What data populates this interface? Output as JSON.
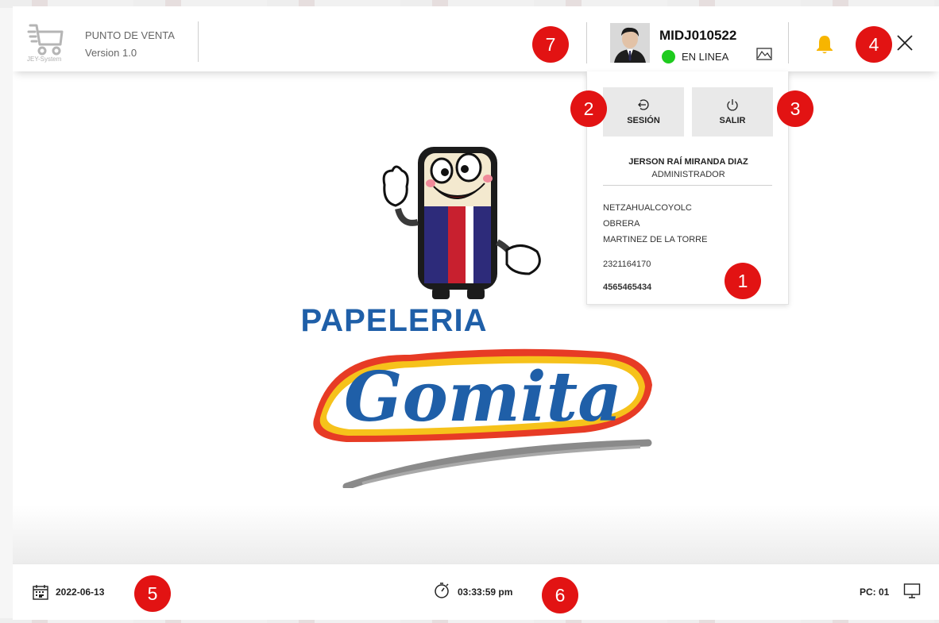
{
  "brand": {
    "title": "PUNTO DE VENTA",
    "version": "Version 1.0",
    "sub": "JEY-System"
  },
  "header": {
    "user_id": "MIDJ010522",
    "status_text": "EN LINEA"
  },
  "dropdown": {
    "session_label": "SESIÓN",
    "exit_label": "SALIR",
    "name": "JERSON RAÍ MIRANDA DIAZ",
    "role": "ADMINISTRADOR",
    "location": "NETZAHUALCOYOLC",
    "area": "OBRERA",
    "street": "MARTINEZ DE LA TORRE",
    "phone": "2321164170",
    "number": "4565465434"
  },
  "logo": {
    "line1": "PAPELERIA",
    "line2": "Gomita"
  },
  "footer": {
    "date": "2022-06-13",
    "time": "03:33:59 pm",
    "pc": "PC: 01"
  },
  "badges": [
    "1",
    "2",
    "3",
    "4",
    "5",
    "6",
    "7"
  ],
  "colors": {
    "badge": "#e21313",
    "online": "#1ecb1e",
    "bell": "#f7b500",
    "logo_blue": "#1f5fa8"
  }
}
